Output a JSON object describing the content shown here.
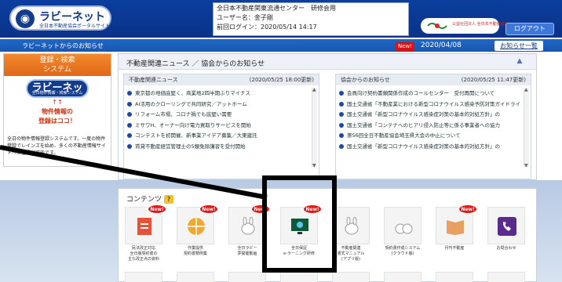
{
  "header": {
    "logo_text": "ラビーネット",
    "logo_sub": "全日本不動産協会ポータルサイト",
    "user_lines": [
      "全日本不動産関東流通センター　研修会用",
      "ユーザー名：金子剛",
      "前回ログイン：2020/05/14 14:17"
    ],
    "brand_text": "公益社団法人 全日本不動産協会",
    "logout_label": "ログアウト"
  },
  "notice_bar": {
    "left_title": "ラビーネットからのお知らせ",
    "new_badge": "New!",
    "date": "2020/04/08",
    "list_button": "お知らせ一覧"
  },
  "search_panel": {
    "head": "登録・検索\nシステム",
    "button": "ラビーネット",
    "button_sub": "全日物件情報・検索システム",
    "arrows": "↑↑",
    "link": "物件情報の\n登録はココ！",
    "desc": "全日の物件情報登録システムです。一度の物件登録でレインズを始め、多くの不動産情報サイトへの登録が可能です。"
  },
  "news": {
    "title": "不動産関連ニュース ／ 協会からのお知らせ",
    "left": {
      "head": "不動産関連ニュース",
      "date": "(2020/05/25 18:00更新)",
      "items": [
        "東京都の地価底堅く、商業地2四半期ぶりマイナス",
        "AI活用のクローリングで共同研究／アットホーム",
        "リフォーム市場、コロナ禍でも底堅い需要",
        "ミサワH、オーナー向け電力買取りサービスを開始",
        "コンテストを初開催、新事業アイデア募集／大東建託",
        "賃貸不動産経営管理士の5類免除講習を受付開始"
      ]
    },
    "right": {
      "head": "協会からのお知らせ",
      "date": "(2020/05/25 11:47更新)",
      "items": [
        "会員向け契約書類関係作成のコールセンター　受付再開について",
        "国土交通省「不動産業における新型コロナウイルス感染予防対策ガイドライン」",
        "国土交通省「新型コロナウイルス感染症対策の基本的対処方針」の",
        "国土交通省「コンテナへのヒアリ侵入防止等に係る事業者への協力",
        "第56回全日不動産協会埼玉県大会の中止について",
        "国土交通省「新型コロナウイルス感染症対策の基本的対処方針」の"
      ]
    }
  },
  "contents": {
    "title": "コンテンツ",
    "help": "?",
    "tiles": [
      {
        "label": "民法改正対応\n全日版契約書の\n主な改正点の資料",
        "new": true,
        "icon": "document-icon"
      },
      {
        "label": "作業提供\n契約書類例集",
        "new": true,
        "icon": "globe-icon"
      },
      {
        "label": "全日ラビー\n夢開催動画",
        "new": true,
        "icon": "rabbit-icon"
      },
      {
        "label": "全日保証\ne-ラーニング研修",
        "new": true,
        "icon": "monitor-icon"
      },
      {
        "label": "不動産関連\n書式マニュアル\n(アプリ版)",
        "new": false,
        "icon": "rabbit-icon"
      },
      {
        "label": "契約書作成システム\n(クラウド版)",
        "new": false,
        "icon": "rabbit-pair-icon"
      },
      {
        "label": "月刊不動産",
        "new": true,
        "icon": "book-icon"
      },
      {
        "label": "お問合わせ",
        "new": false,
        "icon": "phone-icon"
      }
    ]
  },
  "colors": {
    "header": "#0b3388",
    "accent": "#1f68c8",
    "new": "#e01818",
    "orange": "#e06718"
  }
}
